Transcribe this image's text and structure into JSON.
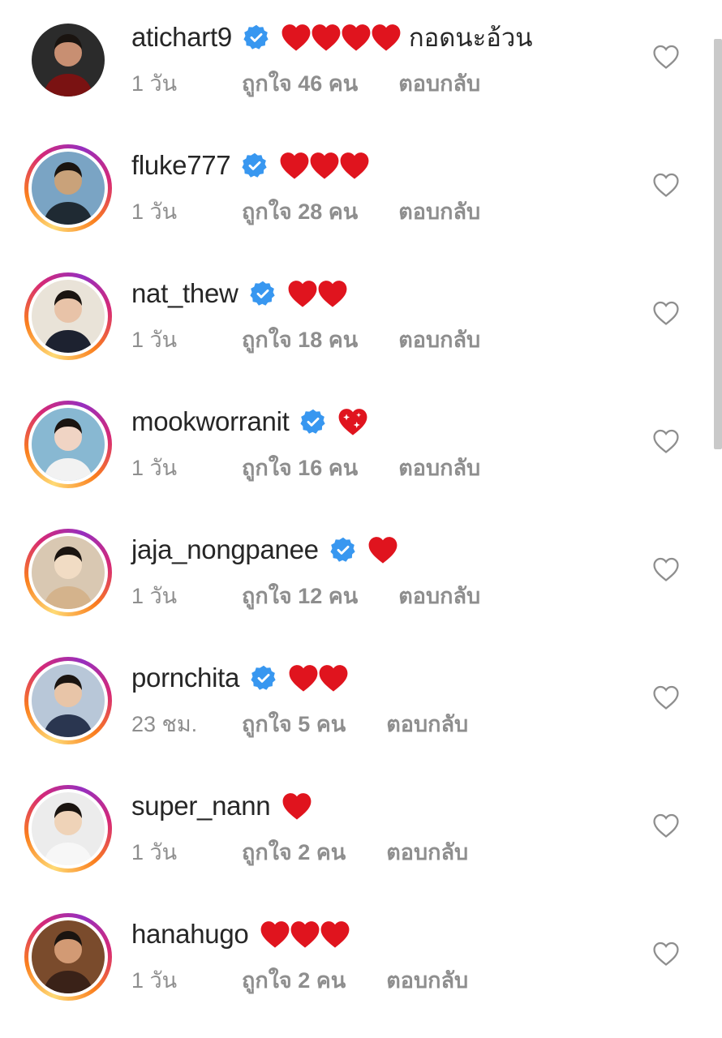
{
  "comments": [
    {
      "username": "atichart9",
      "verified": true,
      "hearts": 4,
      "heart_type": "red",
      "text": "กอดนะอ้วน",
      "time": "1 วัน",
      "likes": "ถูกใจ 46 คน",
      "reply": "ตอบกลับ",
      "story_ring": false
    },
    {
      "username": "fluke777",
      "verified": true,
      "hearts": 3,
      "heart_type": "red",
      "text": "",
      "time": "1 วัน",
      "likes": "ถูกใจ 28 คน",
      "reply": "ตอบกลับ",
      "story_ring": true
    },
    {
      "username": "nat_thew",
      "verified": true,
      "hearts": 2,
      "heart_type": "red",
      "text": "",
      "time": "1 วัน",
      "likes": "ถูกใจ 18 คน",
      "reply": "ตอบกลับ",
      "story_ring": true
    },
    {
      "username": "mookworranit",
      "verified": true,
      "hearts": 1,
      "heart_type": "sparkling",
      "text": "",
      "time": "1 วัน",
      "likes": "ถูกใจ 16 คน",
      "reply": "ตอบกลับ",
      "story_ring": true
    },
    {
      "username": "jaja_nongpanee",
      "verified": true,
      "hearts": 1,
      "heart_type": "red",
      "text": "",
      "time": "1 วัน",
      "likes": "ถูกใจ 12 คน",
      "reply": "ตอบกลับ",
      "story_ring": true
    },
    {
      "username": "pornchita",
      "verified": true,
      "hearts": 2,
      "heart_type": "red",
      "text": "",
      "time": "23 ชม.",
      "likes": "ถูกใจ 5 คน",
      "reply": "ตอบกลับ",
      "story_ring": true
    },
    {
      "username": "super_nann",
      "verified": false,
      "hearts": 1,
      "heart_type": "red",
      "text": "",
      "time": "1 วัน",
      "likes": "ถูกใจ 2 คน",
      "reply": "ตอบกลับ",
      "story_ring": true
    },
    {
      "username": "hanahugo",
      "verified": false,
      "hearts": 3,
      "heart_type": "red",
      "text": "",
      "time": "1 วัน",
      "likes": "ถูกใจ 2 คน",
      "reply": "ตอบกลับ",
      "story_ring": true
    }
  ],
  "colors": {
    "verified": "#3897f0",
    "heart": "#e0141e",
    "muted": "#8e8e8e",
    "text": "#262626"
  },
  "icons": {
    "like": "heart-outline-icon",
    "verified": "verified-badge-icon"
  }
}
